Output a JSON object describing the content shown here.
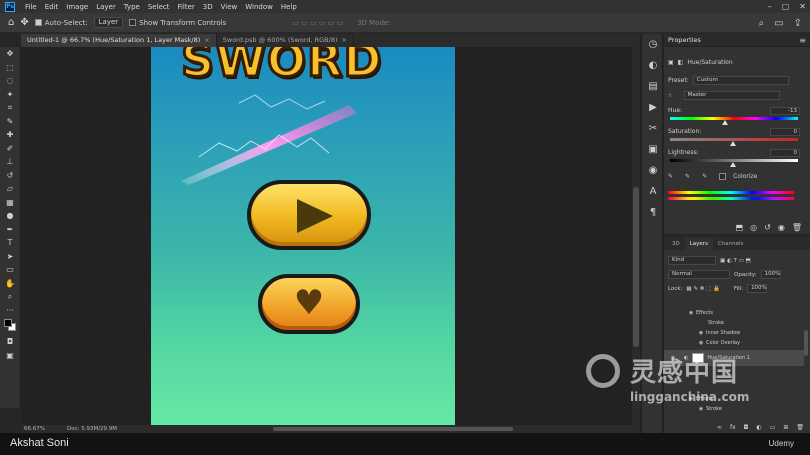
{
  "menubar": {
    "items": [
      "File",
      "Edit",
      "Image",
      "Layer",
      "Type",
      "Select",
      "Filter",
      "3D",
      "View",
      "Window",
      "Help"
    ]
  },
  "options": {
    "auto_select_label": "Auto-Select:",
    "layer_select": "Layer",
    "transform_label": "Show Transform Controls",
    "mode_3d": "3D Mode:"
  },
  "tabs": [
    {
      "label": "Untitled-1 @ 66.7% (Hue/Saturation 1, Layer Mask/8)",
      "active": true
    },
    {
      "label": "Sword.psb @ 600% (Sword, RGB/8)",
      "active": false
    }
  ],
  "status": {
    "zoom": "66.67%",
    "doc": "Doc: 5.93M/29.9M"
  },
  "properties": {
    "title": "Properties",
    "adjustment": "Hue/Saturation",
    "preset_label": "Preset:",
    "preset_value": "Custom",
    "channel": "Master",
    "hue_label": "Hue:",
    "hue_value": "-13",
    "saturation_label": "Saturation:",
    "saturation_value": "0",
    "lightness_label": "Lightness:",
    "lightness_value": "0",
    "colorize_label": "Colorize"
  },
  "layers": {
    "tabs": [
      "3D",
      "Layers",
      "Channels"
    ],
    "filter": "Kind",
    "blend_mode": "Normal",
    "opacity_label": "Opacity:",
    "opacity_value": "100%",
    "lock_label": "Lock:",
    "fill_label": "Fill:",
    "fill_value": "100%",
    "items": [
      {
        "name": "Effects",
        "indent": 1
      },
      {
        "name": "Stroke",
        "indent": 2
      },
      {
        "name": "Inner Shadow",
        "indent": 2
      },
      {
        "name": "Color Overlay",
        "indent": 2
      },
      {
        "name": "Hue/Saturation 1",
        "indent": 0,
        "selected": true
      },
      {
        "name": "Effects",
        "indent": 1
      },
      {
        "name": "Stroke",
        "indent": 2
      }
    ]
  },
  "artboard": {
    "title_text": "SWORD"
  },
  "watermark": {
    "text": "灵感中国",
    "url": "lingganchina.com"
  },
  "caption": {
    "author": "Akshat Soni",
    "brand": "Udemy"
  }
}
